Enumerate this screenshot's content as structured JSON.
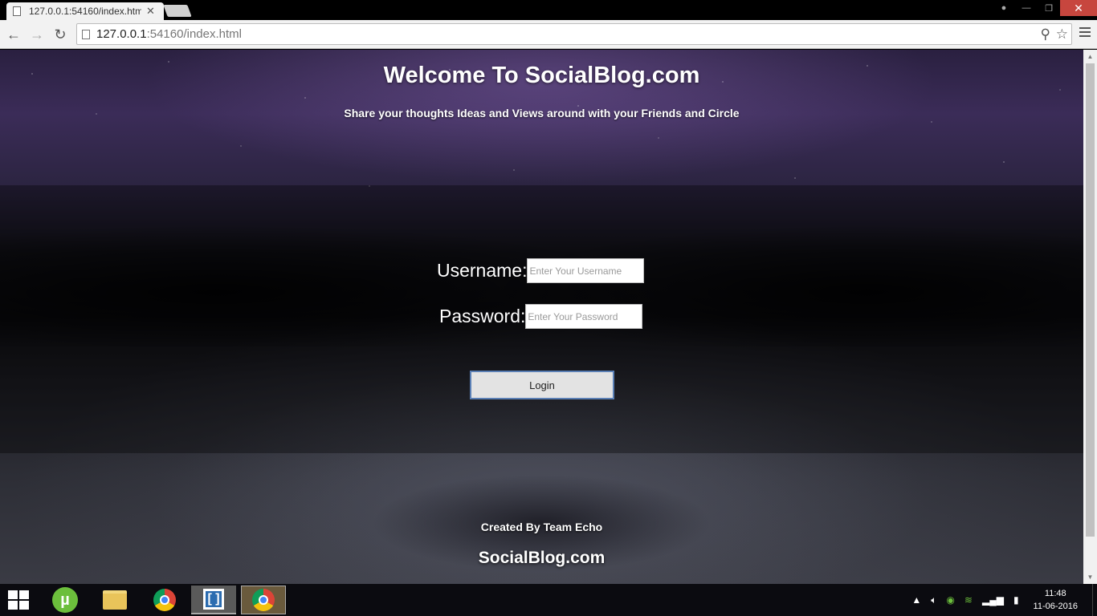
{
  "browser": {
    "tab_title": "127.0.0.1:54160/index.htm",
    "url_host": "127.0.0.1",
    "url_rest": ":54160/index.html",
    "window_controls": [
      "user-icon",
      "minimize-icon",
      "restore-icon",
      "close-icon"
    ]
  },
  "page": {
    "title": "Welcome To SocialBlog.com",
    "subtitle": "Share your thoughts Ideas and Views around with your Friends and Circle",
    "username_label": "Username:",
    "username_placeholder": "Enter Your Username",
    "password_label": "Password:",
    "password_placeholder": "Enter Your Password",
    "login_label": "Login",
    "footer_credit": "Created By Team Echo",
    "footer_brand": "SocialBlog.com"
  },
  "taskbar": {
    "apps": [
      "utorrent",
      "file-explorer",
      "chrome",
      "brackets",
      "chrome-active"
    ],
    "clock_time": "11:48",
    "clock_date": "11-06-2016"
  },
  "colors": {
    "login_border": "#5a7fb5",
    "close_button": "#c7463e"
  }
}
